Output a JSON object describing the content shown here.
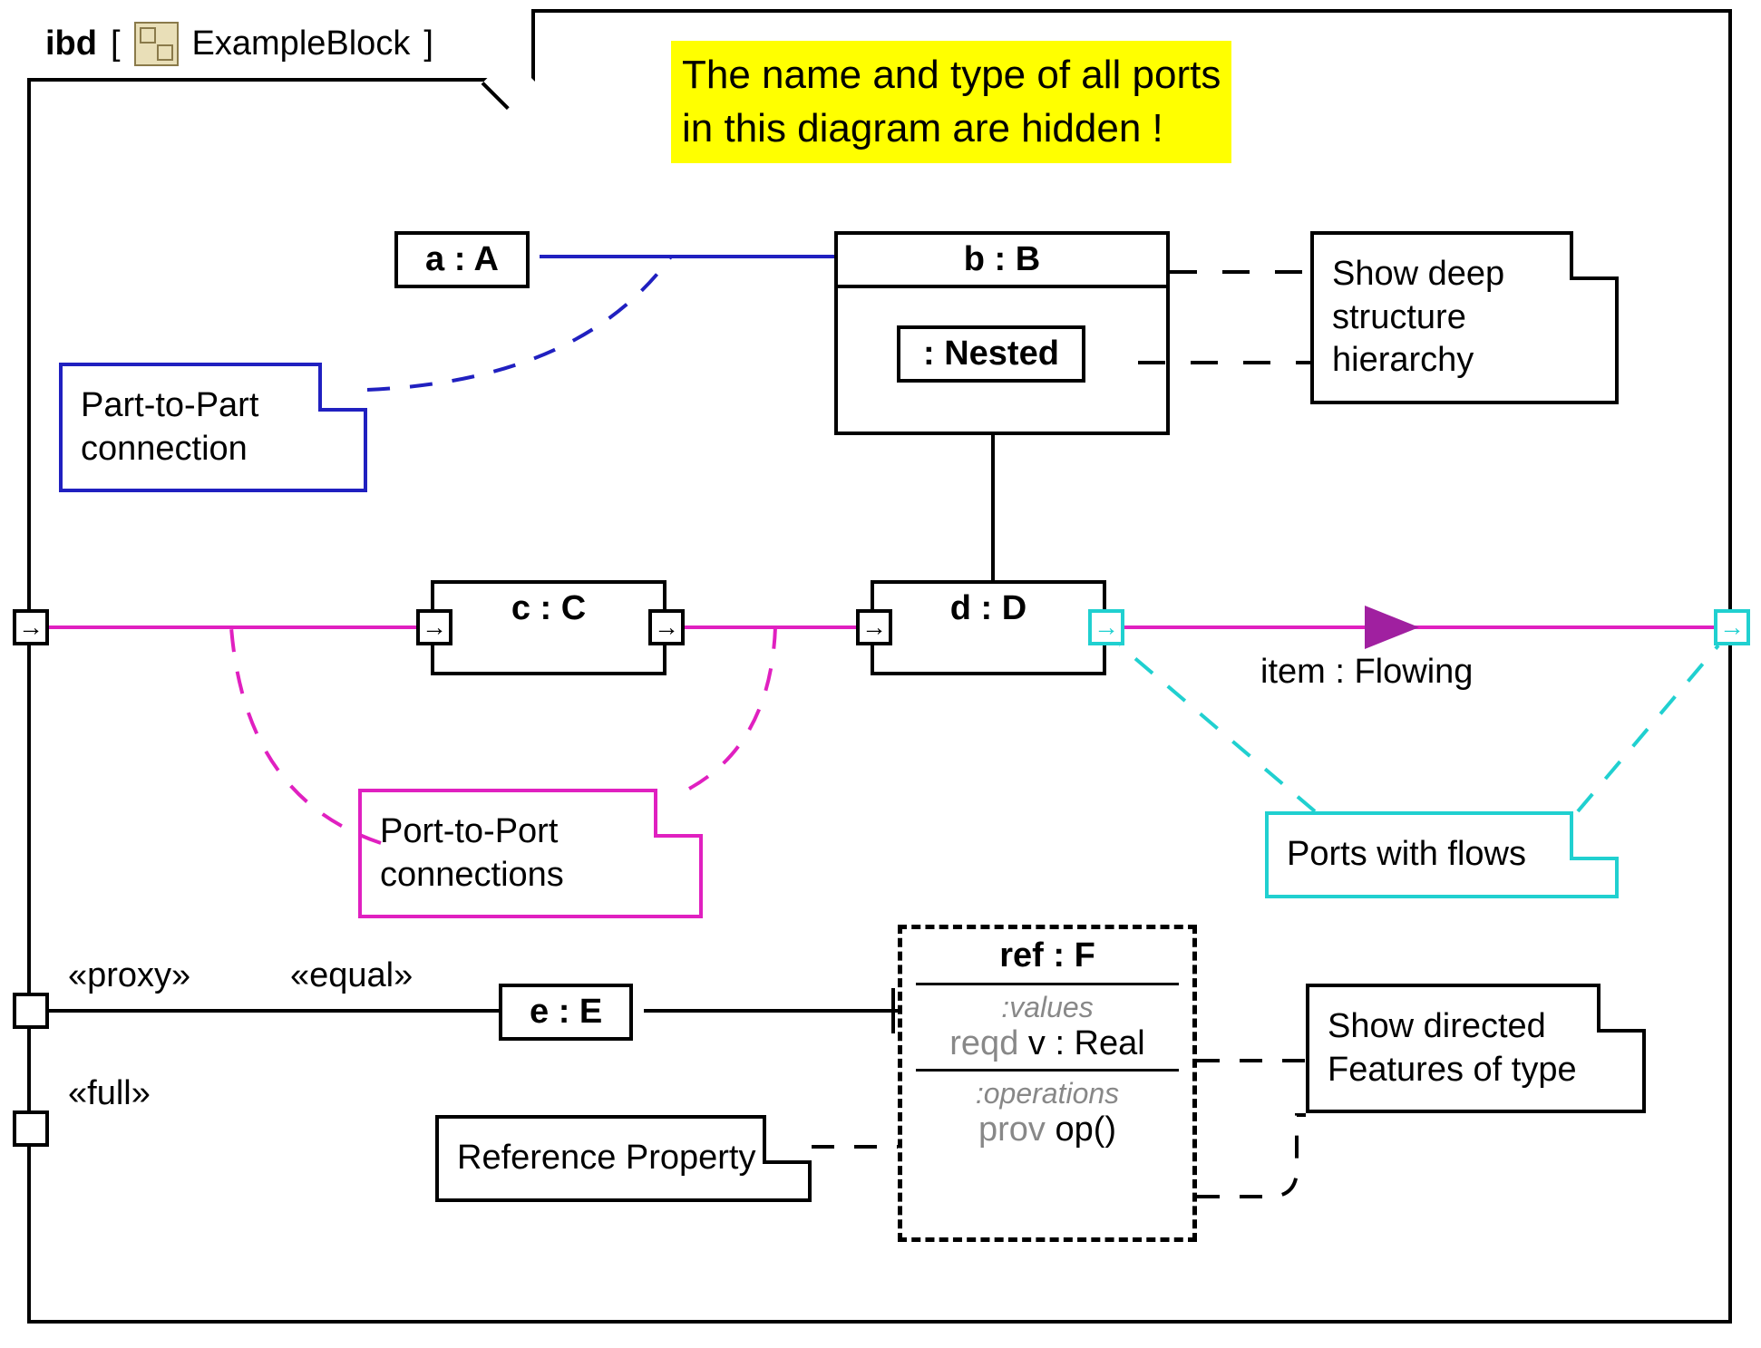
{
  "frame": {
    "kind": "ibd",
    "name": "ExampleBlock"
  },
  "highlight_note": "The name and type of all ports\nin this diagram are hidden !",
  "blocks": {
    "a": {
      "label": "a : A"
    },
    "b": {
      "label": "b : B",
      "nested_label": ": Nested"
    },
    "c": {
      "label": "c : C"
    },
    "d": {
      "label": "d : D"
    },
    "e": {
      "label": "e : E"
    }
  },
  "ref": {
    "title": "ref : F",
    "values_heading": ":values",
    "values_body_prefix": "reqd",
    "values_body_text": " v : Real",
    "operations_heading": ":operations",
    "operations_body_prefix": "prov",
    "operations_body_text": " op()"
  },
  "notes": {
    "part_to_part": "Part-to-Part\nconnection",
    "port_to_port": "Port-to-Port\nconnections",
    "ports_with_flows": "Ports with flows",
    "deep_structure": "Show deep\nstructure\nhierarchy",
    "reference_property": "Reference Property",
    "directed_features": "Show directed\nFeatures of type"
  },
  "labels": {
    "proxy": "«proxy»",
    "full": "«full»",
    "equal": "«equal»",
    "item_flow": "item : Flowing"
  },
  "colors": {
    "blue": "#2020c0",
    "magenta": "#e020c0",
    "cyan": "#20d0d0",
    "flow_arrow": "#a020a0"
  }
}
